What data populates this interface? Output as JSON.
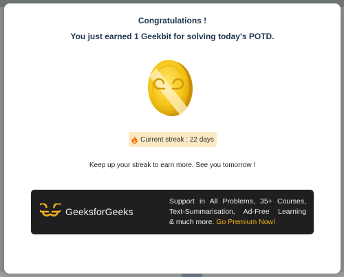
{
  "modal": {
    "title": "Congratulations !",
    "subtitle": "You just earned 1 Geekbit for solving today's POTD.",
    "coin_icon": "geekbit-coin-icon",
    "streak": {
      "icon": "flame-icon",
      "text": "Current streak : 22 days"
    },
    "message": "Keep up your streak to earn more. See you tomorrow !"
  },
  "promo": {
    "brand": "GeeksforGeeks",
    "logo_icon": "gfg-logo-icon",
    "line1": "Support in All Problems, 35+ Courses,",
    "line2": "Text-Summarisation, Ad-Free Learning",
    "line3_prefix": "& much more.",
    "cta": "Go Premium Now!"
  },
  "colors": {
    "heading": "#22364e",
    "coin_gold": "#f5c518",
    "badge_bg": "#fbe9c4",
    "promo_bg": "#1f1f1f",
    "cta": "#f2b01e"
  }
}
